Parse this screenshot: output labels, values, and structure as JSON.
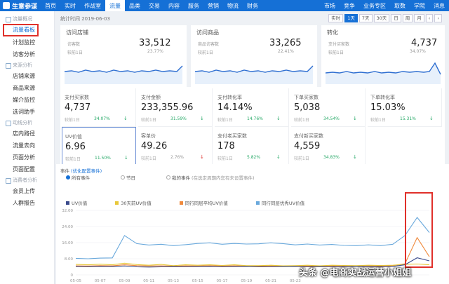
{
  "app": {
    "title": "生意参谋"
  },
  "nav": [
    "首页",
    "实时",
    "作战室",
    "流量",
    "品类",
    "交易",
    "内容",
    "服务",
    "营销",
    "物流",
    "财务",
    "市场",
    "竞争",
    "业务专区",
    "取数",
    "学院"
  ],
  "nav_active": 3,
  "user": "消息",
  "sidebar": {
    "sections": [
      {
        "title": "流量概况",
        "items": [
          "流量看板",
          "计划监控",
          "访客分析"
        ]
      },
      {
        "title": "来源分析",
        "items": [
          "店铺来源",
          "商品来源",
          "媒介监控",
          "选词助手"
        ]
      },
      {
        "title": "动线分析",
        "items": [
          "店内路径",
          "流量去向",
          "页面分析",
          "页面配置"
        ]
      },
      {
        "title": "消费者分析",
        "items": [
          "会员上传",
          "人群报告"
        ]
      }
    ],
    "active": "流量看板"
  },
  "toolbar": {
    "stat_time": "统计时间 2019-06-03",
    "buttons": [
      "实时",
      "1天",
      "7天",
      "30天",
      "日",
      "周",
      "月",
      "‹",
      "›"
    ],
    "active_button": "1天"
  },
  "top_cards": [
    {
      "title": "访问店铺",
      "sub": "访客数",
      "value": "33,512",
      "compare": "较前1日",
      "pct": "23.77%"
    },
    {
      "title": "访问商品",
      "sub": "商品访客数",
      "value": "33,265",
      "compare": "较前1日",
      "pct": "22.41%"
    },
    {
      "title": "转化",
      "sub": "支付买家数",
      "value": "4,737",
      "compare": "较前1日",
      "pct": "34.07%"
    }
  ],
  "metrics": [
    {
      "title": "支付买家数",
      "value": "4,737",
      "compare": "较前1日",
      "pct": "34.07%",
      "dir": "up"
    },
    {
      "title": "支付金额",
      "value": "233,355.96",
      "compare": "较前1日",
      "pct": "31.59%",
      "dir": "up"
    },
    {
      "title": "支付转化率",
      "value": "14.14%",
      "compare": "较前1日",
      "pct": "14.76%",
      "dir": "up"
    },
    {
      "title": "下单买家数",
      "value": "5,038",
      "compare": "较前1日",
      "pct": "34.54%",
      "dir": "up"
    },
    {
      "title": "下单转化率",
      "value": "15.03%",
      "compare": "较前1日",
      "pct": "15.31%",
      "dir": "up"
    },
    {
      "title": "UV价值",
      "value": "6.96",
      "compare": "较前1日",
      "pct": "11.50%",
      "dir": "up"
    },
    {
      "title": "客单价",
      "value": "49.26",
      "compare": "较前1日",
      "pct": "2.76%",
      "dir": "dn"
    },
    {
      "title": "支付老买家数",
      "value": "178",
      "compare": "较前1日",
      "pct": "5.82%",
      "dir": "up"
    },
    {
      "title": "支付新买家数",
      "value": "4,559",
      "compare": "较前1日",
      "pct": "34.83%",
      "dir": "up"
    }
  ],
  "chart_options": {
    "label": "事件",
    "link": "(优化配置事件)",
    "radios": [
      "所有事件",
      "节日",
      "我的事件"
    ],
    "hint": "(在选定周期内您有未设置事件)"
  },
  "watermark": "头条 @电商实战运营小姐姐",
  "chart_data": {
    "type": "line",
    "x": [
      "05-05",
      "05-06",
      "05-07",
      "05-08",
      "05-09",
      "05-10",
      "05-11",
      "05-12",
      "05-13",
      "05-14",
      "05-15",
      "05-16",
      "05-17",
      "05-18",
      "05-19",
      "05-20",
      "05-21",
      "05-22",
      "05-23",
      "05-24",
      "05-25",
      "05-26",
      "05-27",
      "05-28",
      "05-29",
      "05-30",
      "05-31",
      "06-01",
      "06-02",
      "06-03"
    ],
    "x_tick_labels": [
      "05-05",
      "05-07",
      "05-09",
      "05-11",
      "05-13",
      "05-15",
      "05-17",
      "05-19",
      "05-21",
      "05-23"
    ],
    "ylim": [
      0,
      32
    ],
    "yticks": [
      0,
      8,
      16,
      24,
      32
    ],
    "ytick_labels": [
      "0",
      "8.00",
      "16.00",
      "24.00",
      "32.00"
    ],
    "series": [
      {
        "name": "UV价值",
        "color": "#3a4a8c",
        "values": [
          4.1,
          4.0,
          4.2,
          4.1,
          4.4,
          4.0,
          3.9,
          4.0,
          4.1,
          4.0,
          4.1,
          4.2,
          4.0,
          4.1,
          4.2,
          4.0,
          4.0,
          4.1,
          4.2,
          4.0,
          4.1,
          4.0,
          4.1,
          4.2,
          4.1,
          4.0,
          4.2,
          5.0,
          8.5,
          6.96
        ]
      },
      {
        "name": "30天前UV价值",
        "color": "#e8c83a",
        "values": [
          5.2,
          5.0,
          5.3,
          5.0,
          5.8,
          5.1,
          4.8,
          5.2,
          4.6,
          5.0,
          4.8,
          5.0,
          4.7,
          5.0,
          4.6,
          4.6,
          4.8,
          4.5,
          4.6,
          4.8,
          4.5,
          4.8,
          4.7,
          4.6,
          4.8,
          4.7,
          4.8,
          5.2,
          5.4,
          5.0
        ]
      },
      {
        "name": "同行同层平均UV价值",
        "color": "#f08a3c",
        "values": [
          4.5,
          4.4,
          4.6,
          4.5,
          5.0,
          4.6,
          4.4,
          4.5,
          4.3,
          4.5,
          4.4,
          4.6,
          4.4,
          4.5,
          4.4,
          4.3,
          4.5,
          4.4,
          4.5,
          4.4,
          4.3,
          4.5,
          4.4,
          4.3,
          4.5,
          4.4,
          4.6,
          5.5,
          18.5,
          9.0
        ]
      },
      {
        "name": "同行同层优秀UV价值",
        "color": "#6aa9dc",
        "values": [
          8.2,
          8.0,
          8.3,
          8.4,
          19.5,
          15.5,
          14.8,
          15.2,
          14.5,
          15.0,
          15.6,
          15.9,
          15.2,
          15.6,
          15.3,
          15.4,
          15.9,
          15.5,
          14.9,
          15.3,
          14.8,
          15.1,
          14.6,
          14.5,
          14.9,
          14.5,
          15.2,
          19.5,
          28.5,
          21.0
        ]
      }
    ],
    "grid": true,
    "legend": "top-left"
  }
}
